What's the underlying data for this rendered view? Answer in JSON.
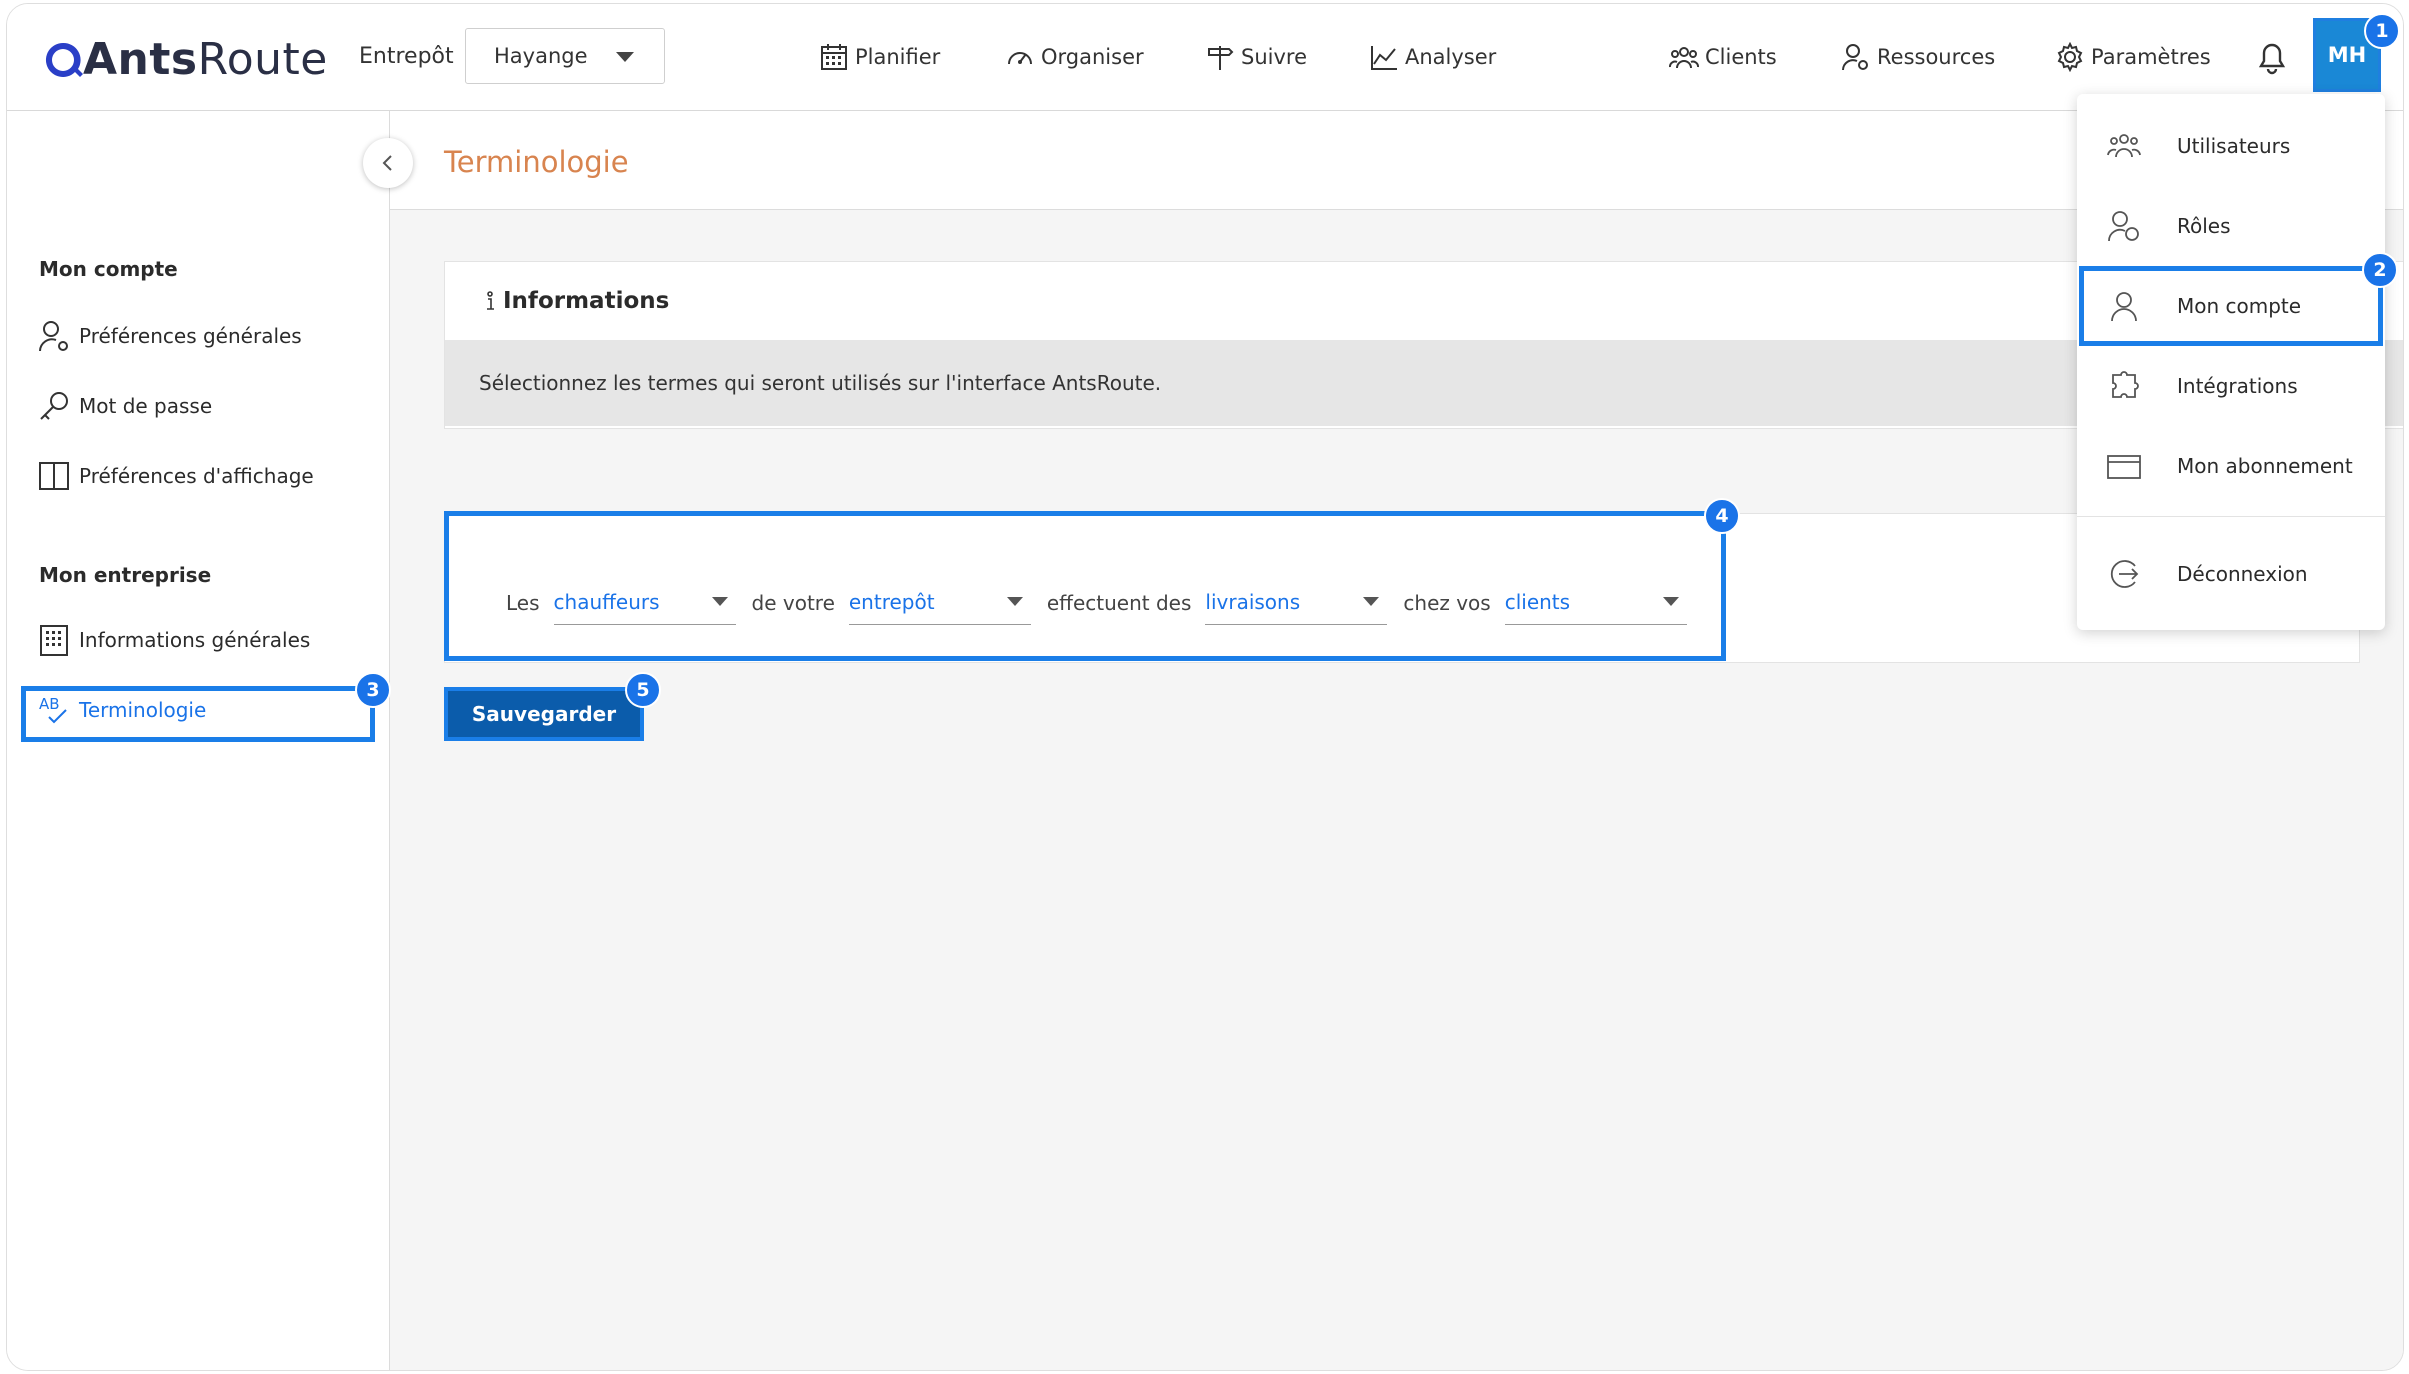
{
  "app": {
    "logo_bold": "Ants",
    "logo_light": "Route"
  },
  "header": {
    "warehouse_label": "Entrepôt",
    "warehouse_value": "Hayange",
    "nav": [
      {
        "label": "Planifier",
        "icon": "calendar-icon"
      },
      {
        "label": "Organiser",
        "icon": "speedometer-icon"
      },
      {
        "label": "Suivre",
        "icon": "signpost-icon"
      },
      {
        "label": "Analyser",
        "icon": "chart-icon"
      },
      {
        "label": "Clients",
        "icon": "group-icon"
      },
      {
        "label": "Ressources",
        "icon": "user-gear-icon"
      },
      {
        "label": "Paramètres",
        "icon": "gear-icon"
      }
    ],
    "avatar_initials": "MH"
  },
  "sidebar": {
    "section_account": "Mon compte",
    "account_items": [
      {
        "label": "Préférences générales",
        "icon": "user-gear-icon"
      },
      {
        "label": "Mot de passe",
        "icon": "key-icon"
      },
      {
        "label": "Préférences d'affichage",
        "icon": "columns-icon"
      }
    ],
    "section_company": "Mon entreprise",
    "company_items": [
      {
        "label": "Informations générales",
        "icon": "building-icon"
      },
      {
        "label": "Terminologie",
        "icon": "spellcheck-icon"
      }
    ]
  },
  "main": {
    "page_title": "Terminologie",
    "info_title": "Informations",
    "info_text": "Sélectionnez les termes qui seront utilisés sur l'interface AntsRoute.",
    "sentence": {
      "w1": "Les",
      "s1": "chauffeurs",
      "w2": "de votre",
      "s2": "entrepôt",
      "w3": "effectuent des",
      "s3": "livraisons",
      "w4": "chez vos",
      "s4": "clients"
    },
    "save_label": "Sauvegarder"
  },
  "menu": {
    "items": [
      {
        "label": "Utilisateurs",
        "icon": "users-icon"
      },
      {
        "label": "Rôles",
        "icon": "roles-icon"
      },
      {
        "label": "Mon compte",
        "icon": "user-icon"
      },
      {
        "label": "Intégrations",
        "icon": "integration-icon"
      },
      {
        "label": "Mon abonnement",
        "icon": "card-icon"
      },
      {
        "label": "Déconnexion",
        "icon": "logout-icon"
      }
    ]
  },
  "badges": [
    "1",
    "2",
    "3",
    "4",
    "5"
  ],
  "colors": {
    "accent": "#1a73e8",
    "highlight": "#1a7ee8",
    "title": "#d8844f",
    "button": "#0b5cab"
  }
}
